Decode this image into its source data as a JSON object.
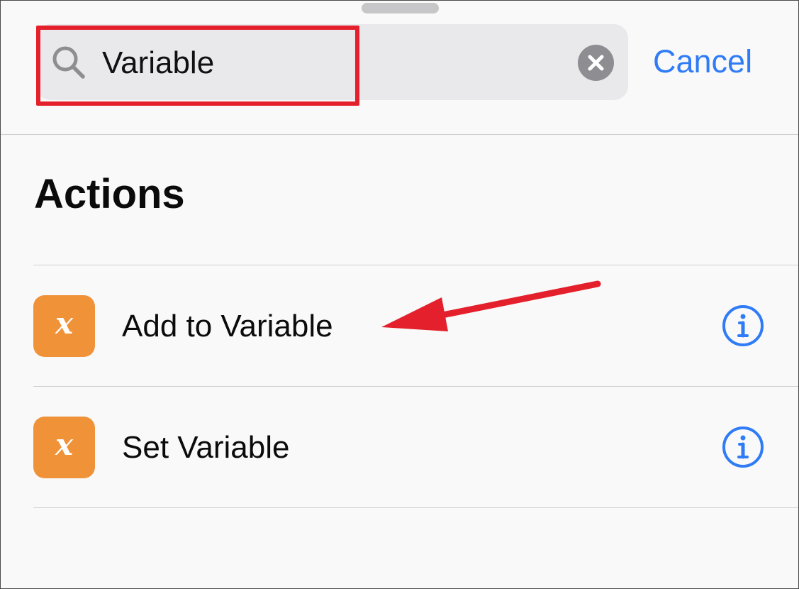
{
  "search": {
    "value": "Variable",
    "clear_icon": "close-circle-icon",
    "search_icon": "magnifying-glass-icon",
    "cancel_label": "Cancel"
  },
  "section": {
    "title": "Actions"
  },
  "actions": [
    {
      "label": "Add to Variable",
      "icon_glyph": "x",
      "icon_name": "variable-icon",
      "info_icon": "info-icon"
    },
    {
      "label": "Set Variable",
      "icon_glyph": "x",
      "icon_name": "variable-icon",
      "info_icon": "info-icon"
    }
  ],
  "colors": {
    "accent": "#2f7cf6",
    "action_icon_bg": "#ef9238",
    "highlight": "#e4202c",
    "background": "#f9f9f9",
    "search_bg": "#e9e9eb"
  }
}
